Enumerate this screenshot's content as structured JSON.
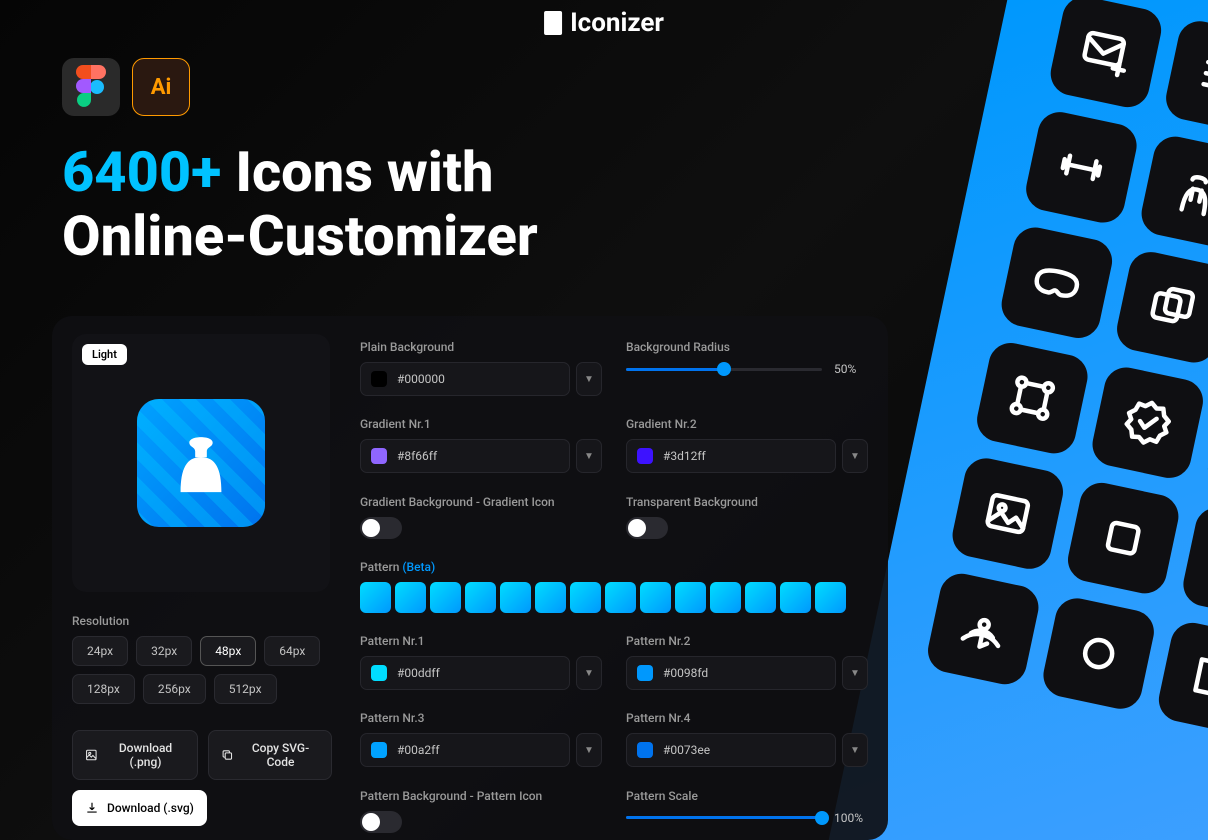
{
  "brand": "Iconizer",
  "headline_accent": "6400+",
  "headline_rest": " Icons with\nOnline-Customizer",
  "preview": {
    "mode_label": "Light"
  },
  "resolution": {
    "label": "Resolution",
    "options": [
      "24px",
      "32px",
      "48px",
      "64px",
      "128px",
      "256px",
      "512px"
    ],
    "selected": "48px"
  },
  "actions": {
    "download_png": "Download (.png)",
    "copy_svg": "Copy SVG-Code",
    "download_svg": "Download (.svg)"
  },
  "controls": {
    "plain_bg": {
      "label": "Plain Background",
      "value": "#000000",
      "swatch": "#000000"
    },
    "bg_radius": {
      "label": "Background Radius",
      "value": "50%",
      "percent": 50
    },
    "grad1": {
      "label": "Gradient Nr.1",
      "value": "#8f66ff",
      "swatch": "#8f66ff"
    },
    "grad2": {
      "label": "Gradient Nr.2",
      "value": "#3d12ff",
      "swatch": "#3d12ff"
    },
    "grad_bg_icon": {
      "label": "Gradient Background - Gradient Icon"
    },
    "transparent_bg": {
      "label": "Transparent Background"
    },
    "pattern_label": "Pattern ",
    "pattern_beta": "(Beta)",
    "pat1": {
      "label": "Pattern Nr.1",
      "value": "#00ddff",
      "swatch": "#00ddff"
    },
    "pat2": {
      "label": "Pattern Nr.2",
      "value": "#0098fd",
      "swatch": "#0098fd"
    },
    "pat3": {
      "label": "Pattern Nr.3",
      "value": "#00a2ff",
      "swatch": "#00a2ff"
    },
    "pat4": {
      "label": "Pattern Nr.4",
      "value": "#0073ee",
      "swatch": "#0073ee"
    },
    "pat_bg_icon": {
      "label": "Pattern Background - Pattern Icon"
    },
    "pat_scale": {
      "label": "Pattern Scale",
      "value": "100%",
      "percent": 100
    }
  }
}
